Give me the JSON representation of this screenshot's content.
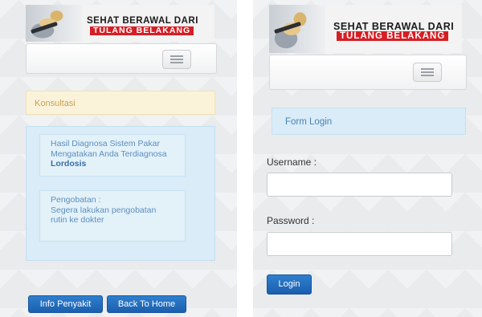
{
  "banner": {
    "line1": "SEHAT BERAWAL DARI",
    "line2": "TULANG BELAKANG"
  },
  "left_screen": {
    "panel_title": "Konsultasi",
    "diagnosis_text": "Hasil Diagnosa Sistem Pakar Mengatakan Anda Terdiagnosa",
    "diagnosis_result": "Lordosis",
    "treatment_title": "Pengobatan :",
    "treatment_text": "Segera lakukan pengobatan rutin ke dokter",
    "buttons": {
      "info": "Info Penyakit",
      "home": "Back To Home"
    }
  },
  "right_screen": {
    "panel_title": "Form Login",
    "username_label": "Username :",
    "username_value": "",
    "password_label": "Password :",
    "password_value": "",
    "login_button": "Login"
  },
  "colors": {
    "button_blue": "#1b5fae",
    "info_panel": "#d9ecf7",
    "warning_panel": "#fbf3d9",
    "banner_red": "#d51f25"
  }
}
